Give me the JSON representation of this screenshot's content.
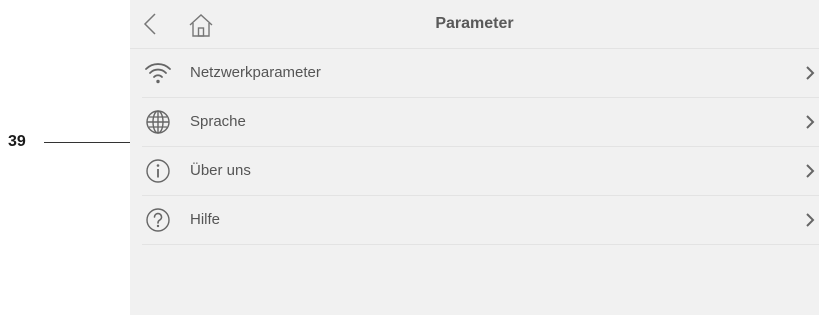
{
  "callout": {
    "number": "39"
  },
  "header": {
    "title": "Parameter",
    "back_icon": "chevron-left-icon",
    "home_icon": "home-icon"
  },
  "menu": {
    "items": [
      {
        "label": "Netzwerkparameter",
        "icon": "wifi-icon"
      },
      {
        "label": "Sprache",
        "icon": "globe-icon"
      },
      {
        "label": "Über uns",
        "icon": "info-icon"
      },
      {
        "label": "Hilfe",
        "icon": "help-icon"
      }
    ]
  },
  "colors": {
    "background": "#f1f1f1",
    "divider": "#e3e3e3",
    "text": "#555555",
    "icon": "#666666"
  }
}
